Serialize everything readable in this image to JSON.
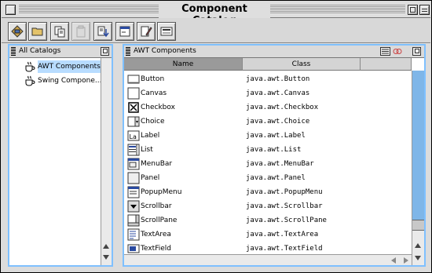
{
  "window": {
    "title": "Component Catalog"
  },
  "toolbar": {
    "buttons": [
      {
        "name": "catalog-icon",
        "disabled": false
      },
      {
        "name": "folder-icon",
        "disabled": false
      },
      {
        "name": "copy-icon",
        "disabled": false
      },
      {
        "name": "paste-icon",
        "disabled": true
      },
      {
        "name": "import-icon",
        "disabled": false
      },
      {
        "name": "add-component-icon",
        "disabled": false
      },
      {
        "name": "edit-icon",
        "disabled": false
      },
      {
        "name": "properties-icon",
        "disabled": false
      }
    ]
  },
  "left_pane": {
    "title": "All Catalogs",
    "items": [
      {
        "label": "AWT Components",
        "selected": true
      },
      {
        "label": "Swing Compone...",
        "selected": false
      }
    ]
  },
  "right_pane": {
    "title": "AWT Components",
    "columns": [
      "Name",
      "Class"
    ],
    "rows": [
      {
        "name": "Button",
        "class": "java.awt.Button",
        "icon": "button-icon"
      },
      {
        "name": "Canvas",
        "class": "java.awt.Canvas",
        "icon": "canvas-icon"
      },
      {
        "name": "Checkbox",
        "class": "java.awt.Checkbox",
        "icon": "checkbox-icon"
      },
      {
        "name": "Choice",
        "class": "java.awt.Choice",
        "icon": "choice-icon"
      },
      {
        "name": "Label",
        "class": "java.awt.Label",
        "icon": "label-icon"
      },
      {
        "name": "List",
        "class": "java.awt.List",
        "icon": "list-icon"
      },
      {
        "name": "MenuBar",
        "class": "java.awt.MenuBar",
        "icon": "menubar-icon"
      },
      {
        "name": "Panel",
        "class": "java.awt.Panel",
        "icon": "panel-icon"
      },
      {
        "name": "PopupMenu",
        "class": "java.awt.PopupMenu",
        "icon": "popupmenu-icon"
      },
      {
        "name": "Scrollbar",
        "class": "java.awt.Scrollbar",
        "icon": "scrollbar-icon"
      },
      {
        "name": "ScrollPane",
        "class": "java.awt.ScrollPane",
        "icon": "scrollpane-icon"
      },
      {
        "name": "TextArea",
        "class": "java.awt.TextArea",
        "icon": "textarea-icon"
      },
      {
        "name": "TextField",
        "class": "java.awt.TextField",
        "icon": "textfield-icon"
      }
    ]
  },
  "colors": {
    "pane_focus_border": "#7fc0ff",
    "selection": "#b8dcff",
    "sorted_column": "#9a9a9a"
  }
}
